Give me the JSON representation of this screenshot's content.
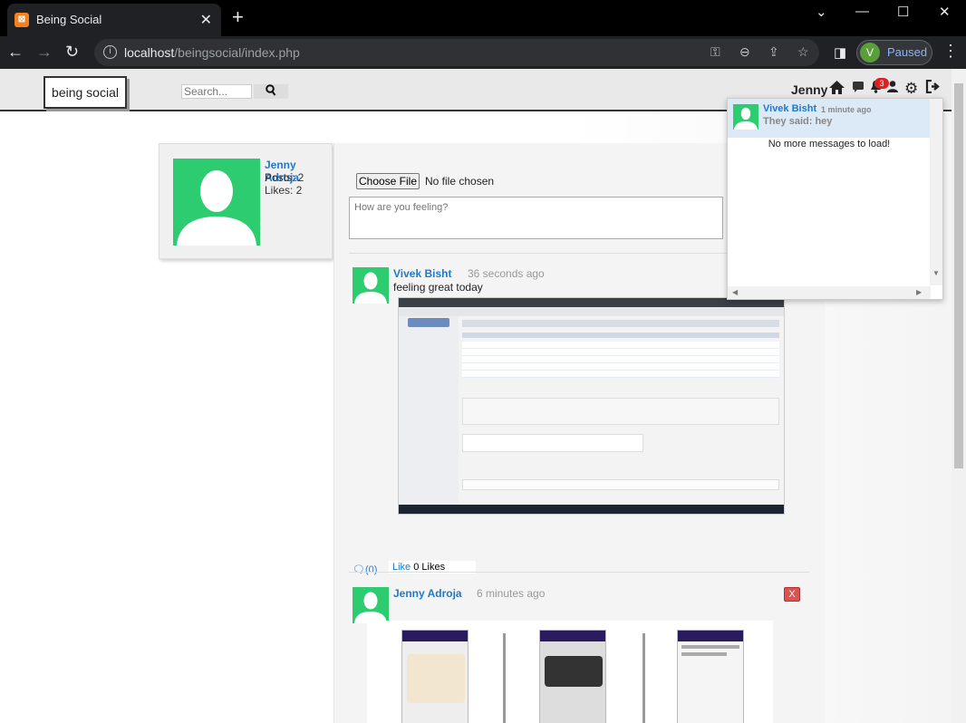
{
  "browser": {
    "tab_title": "Being Social",
    "url_host": "localhost",
    "url_path": "/beingsocial/index.php",
    "profile_initial": "V",
    "profile_status": "Paused"
  },
  "header": {
    "logo": "being social",
    "search_placeholder": "Search...",
    "user": "Jenny",
    "notification_count": "3"
  },
  "profile_card": {
    "name": "Jenny Adroja",
    "posts": "Posts: 2",
    "likes": "Likes: 2"
  },
  "composer": {
    "choose_file": "Choose File",
    "no_file": "No file chosen",
    "placeholder": "How are you feeling?"
  },
  "posts": [
    {
      "author": "Vivek Bisht",
      "time": "36 seconds ago",
      "text": "feeling great today",
      "comments": "(0)",
      "like": "Like",
      "likes": "0 Likes"
    },
    {
      "author": "Jenny Adroja",
      "time": "6 minutes ago",
      "delete": "X"
    }
  ],
  "messages": {
    "from": "Vivek Bisht",
    "time": "1 minute ago",
    "body": "They said: hey",
    "footer": "No more messages to load!"
  },
  "colors": {
    "accent": "#2278c9",
    "avatar": "#2ecc71",
    "delete": "#d9534f",
    "badge": "#e02020"
  }
}
